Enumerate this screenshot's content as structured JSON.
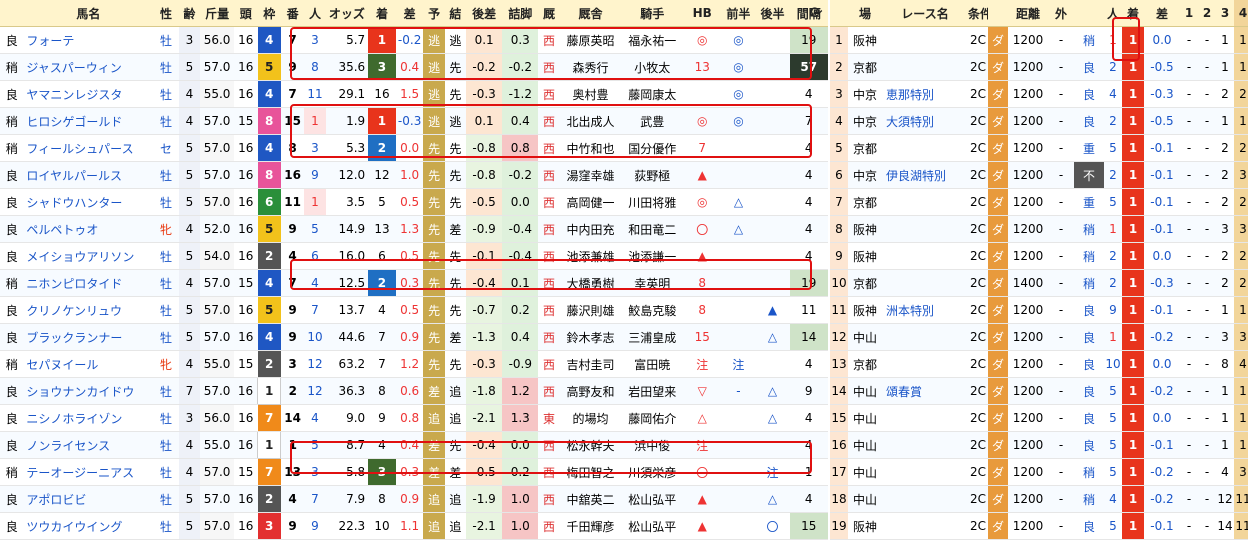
{
  "headers_left": [
    "",
    "馬名",
    "性",
    "齢",
    "斤量",
    "頭",
    "枠",
    "番",
    "人",
    "オッズ",
    "着",
    "差",
    "予",
    "結",
    "後差",
    "詰脚",
    "厩",
    "厩舎",
    "騎手",
    "HB",
    "前半",
    "後半",
    "間隔"
  ],
  "refresh_icon": "refresh-icon",
  "headers_right": [
    "",
    "場",
    "レース名",
    "条件",
    "",
    "距離",
    "外",
    "",
    "人",
    "着",
    "差",
    "1",
    "2",
    "3",
    "4"
  ],
  "rows": [
    {
      "cond": "良",
      "name": "フォーテ",
      "sex": "牡",
      "age": "3",
      "weight": "56.0",
      "heads": "16",
      "waku": "4",
      "uma": "7",
      "ninki": "3",
      "odds": "5.7",
      "finish": "1",
      "diff": "-0.2",
      "pred": "逃",
      "res": "逃",
      "go": "0.1",
      "tsume": "0.3",
      "zai": "西",
      "stable": "藤原英昭",
      "jockey": "福永祐一",
      "hb": "◎",
      "first": "◎",
      "second": "",
      "gap": "19",
      "rnk": "1",
      "place": "阪神",
      "race": "",
      "kind": "2C",
      "track": "ダ",
      "dist": "1200",
      "soto": "-",
      "field": "稍",
      "pop": "1",
      "fin2": "1",
      "d2": "0.0",
      "p1": "-",
      "p2": "-",
      "p3": "1",
      "p4": "1"
    },
    {
      "cond": "稍",
      "name": "ジャスパーウィン",
      "sex": "牡",
      "age": "5",
      "weight": "57.0",
      "heads": "16",
      "waku": "5",
      "uma": "9",
      "ninki": "8",
      "odds": "35.6",
      "finish": "3",
      "diff": "0.4",
      "pred": "逃",
      "res": "先",
      "go": "-0.2",
      "tsume": "-0.2",
      "zai": "西",
      "stable": "森秀行",
      "jockey": "小牧太",
      "hb": "13",
      "first": "◎",
      "second": "",
      "gap": "57",
      "rnk": "2",
      "place": "京都",
      "race": "",
      "kind": "2C",
      "track": "ダ",
      "dist": "1200",
      "soto": "-",
      "field": "良",
      "pop": "2",
      "fin2": "1",
      "d2": "-0.5",
      "p1": "-",
      "p2": "-",
      "p3": "1",
      "p4": "1"
    },
    {
      "cond": "良",
      "name": "ヤマニンレジスタ",
      "sex": "牡",
      "age": "4",
      "weight": "55.0",
      "heads": "16",
      "waku": "4",
      "uma": "7",
      "ninki": "11",
      "odds": "29.1",
      "finish": "16",
      "diff": "1.5",
      "pred": "逃",
      "res": "先",
      "go": "-0.3",
      "tsume": "-1.2",
      "zai": "西",
      "stable": "奥村豊",
      "jockey": "藤岡康太",
      "hb": "",
      "first": "◎",
      "second": "",
      "gap": "4",
      "rnk": "3",
      "place": "中京",
      "race": "恵那特別",
      "kind": "2C",
      "track": "ダ",
      "dist": "1200",
      "soto": "-",
      "field": "良",
      "pop": "4",
      "fin2": "1",
      "d2": "-0.3",
      "p1": "-",
      "p2": "-",
      "p3": "2",
      "p4": "2"
    },
    {
      "cond": "稍",
      "name": "ヒロシゲゴールド",
      "sex": "牡",
      "age": "4",
      "weight": "57.0",
      "heads": "15",
      "waku": "8",
      "uma": "15",
      "ninki": "1",
      "odds": "1.9",
      "finish": "1",
      "diff": "-0.3",
      "pred": "逃",
      "res": "逃",
      "go": "0.1",
      "tsume": "0.4",
      "zai": "西",
      "stable": "北出成人",
      "jockey": "武豊",
      "hb": "◎",
      "first": "◎",
      "second": "",
      "gap": "7",
      "rnk": "4",
      "place": "中京",
      "race": "大須特別",
      "kind": "2C",
      "track": "ダ",
      "dist": "1200",
      "soto": "-",
      "field": "良",
      "pop": "2",
      "fin2": "1",
      "d2": "-0.5",
      "p1": "-",
      "p2": "-",
      "p3": "1",
      "p4": "1"
    },
    {
      "cond": "稍",
      "name": "フィールシュパース",
      "sex": "セ",
      "age": "5",
      "weight": "57.0",
      "heads": "16",
      "waku": "4",
      "uma": "8",
      "ninki": "3",
      "odds": "5.3",
      "finish": "2",
      "diff": "0.0",
      "pred": "先",
      "res": "先",
      "go": "-0.8",
      "tsume": "0.8",
      "zai": "西",
      "stable": "中竹和也",
      "jockey": "国分優作",
      "hb": "7",
      "first": "",
      "second": "",
      "gap": "4",
      "rnk": "5",
      "place": "京都",
      "race": "",
      "kind": "2C",
      "track": "ダ",
      "dist": "1200",
      "soto": "-",
      "field": "重",
      "pop": "5",
      "fin2": "1",
      "d2": "-0.1",
      "p1": "-",
      "p2": "-",
      "p3": "2",
      "p4": "2"
    },
    {
      "cond": "良",
      "name": "ロイヤルパールス",
      "sex": "牡",
      "age": "5",
      "weight": "57.0",
      "heads": "16",
      "waku": "8",
      "uma": "16",
      "ninki": "9",
      "odds": "12.0",
      "finish": "12",
      "diff": "1.0",
      "pred": "先",
      "res": "先",
      "go": "-0.8",
      "tsume": "-0.2",
      "zai": "西",
      "stable": "湯窪幸雄",
      "jockey": "荻野極",
      "hb": "▲",
      "first": "",
      "second": "",
      "gap": "4",
      "rnk": "6",
      "place": "中京",
      "race": "伊良湖特別",
      "kind": "2C",
      "track": "ダ",
      "dist": "1200",
      "soto": "-",
      "field": "不",
      "pop": "2",
      "fin2": "1",
      "d2": "-0.1",
      "p1": "-",
      "p2": "-",
      "p3": "2",
      "p4": "3"
    },
    {
      "cond": "良",
      "name": "シャドウハンター",
      "sex": "牡",
      "age": "5",
      "weight": "57.0",
      "heads": "16",
      "waku": "6",
      "uma": "11",
      "ninki": "1",
      "odds": "3.5",
      "finish": "5",
      "diff": "0.5",
      "pred": "先",
      "res": "先",
      "go": "-0.5",
      "tsume": "0.0",
      "zai": "西",
      "stable": "高岡健一",
      "jockey": "川田将雅",
      "hb": "◎",
      "first": "△",
      "second": "",
      "gap": "4",
      "rnk": "7",
      "place": "京都",
      "race": "",
      "kind": "2C",
      "track": "ダ",
      "dist": "1200",
      "soto": "-",
      "field": "重",
      "pop": "5",
      "fin2": "1",
      "d2": "-0.1",
      "p1": "-",
      "p2": "-",
      "p3": "2",
      "p4": "2"
    },
    {
      "cond": "良",
      "name": "ペルペトゥオ",
      "sex": "牝",
      "age": "4",
      "weight": "52.0",
      "heads": "16",
      "waku": "5",
      "uma": "9",
      "ninki": "5",
      "odds": "14.9",
      "finish": "13",
      "diff": "1.3",
      "pred": "先",
      "res": "差",
      "go": "-0.9",
      "tsume": "-0.4",
      "zai": "西",
      "stable": "中内田充",
      "jockey": "和田竜二",
      "hb": "〇",
      "first": "△",
      "second": "",
      "gap": "4",
      "rnk": "8",
      "place": "阪神",
      "race": "",
      "kind": "2C",
      "track": "ダ",
      "dist": "1200",
      "soto": "-",
      "field": "稍",
      "pop": "1",
      "fin2": "1",
      "d2": "-0.1",
      "p1": "-",
      "p2": "-",
      "p3": "3",
      "p4": "3"
    },
    {
      "cond": "良",
      "name": "メイショウアリソン",
      "sex": "牡",
      "age": "5",
      "weight": "54.0",
      "heads": "16",
      "waku": "2",
      "uma": "4",
      "ninki": "6",
      "odds": "16.0",
      "finish": "6",
      "diff": "0.5",
      "pred": "先",
      "res": "先",
      "go": "-0.1",
      "tsume": "-0.4",
      "zai": "西",
      "stable": "池添兼雄",
      "jockey": "池添謙一",
      "hb": "▲",
      "first": "",
      "second": "",
      "gap": "4",
      "rnk": "9",
      "place": "阪神",
      "race": "",
      "kind": "2C",
      "track": "ダ",
      "dist": "1200",
      "soto": "-",
      "field": "稍",
      "pop": "2",
      "fin2": "1",
      "d2": "0.0",
      "p1": "-",
      "p2": "-",
      "p3": "2",
      "p4": "2"
    },
    {
      "cond": "稍",
      "name": "ニホンピロタイド",
      "sex": "牡",
      "age": "4",
      "weight": "57.0",
      "heads": "15",
      "waku": "4",
      "uma": "7",
      "ninki": "4",
      "odds": "12.5",
      "finish": "2",
      "diff": "0.3",
      "pred": "先",
      "res": "先",
      "go": "-0.4",
      "tsume": "0.1",
      "zai": "西",
      "stable": "大橋勇樹",
      "jockey": "幸英明",
      "hb": "8",
      "first": "",
      "second": "",
      "gap": "19",
      "rnk": "10",
      "place": "京都",
      "race": "",
      "kind": "2C",
      "track": "ダ",
      "dist": "1400",
      "soto": "-",
      "field": "稍",
      "pop": "2",
      "fin2": "1",
      "d2": "-0.3",
      "p1": "-",
      "p2": "-",
      "p3": "2",
      "p4": "2"
    },
    {
      "cond": "良",
      "name": "クリノケンリュウ",
      "sex": "牡",
      "age": "5",
      "weight": "57.0",
      "heads": "16",
      "waku": "5",
      "uma": "9",
      "ninki": "7",
      "odds": "13.7",
      "finish": "4",
      "diff": "0.5",
      "pred": "先",
      "res": "先",
      "go": "-0.7",
      "tsume": "0.2",
      "zai": "西",
      "stable": "藤沢則雄",
      "jockey": "鮫島克駿",
      "hb": "8",
      "first": "",
      "second": "▲",
      "gap": "11",
      "rnk": "11",
      "place": "阪神",
      "race": "洲本特別",
      "kind": "2C",
      "track": "ダ",
      "dist": "1200",
      "soto": "-",
      "field": "良",
      "pop": "9",
      "fin2": "1",
      "d2": "-0.1",
      "p1": "-",
      "p2": "-",
      "p3": "1",
      "p4": "1"
    },
    {
      "cond": "良",
      "name": "ブラックランナー",
      "sex": "牡",
      "age": "5",
      "weight": "57.0",
      "heads": "16",
      "waku": "4",
      "uma": "9",
      "ninki": "10",
      "odds": "44.6",
      "finish": "7",
      "diff": "0.9",
      "pred": "先",
      "res": "差",
      "go": "-1.3",
      "tsume": "0.4",
      "zai": "西",
      "stable": "鈴木孝志",
      "jockey": "三浦皇成",
      "hb": "15",
      "first": "",
      "second": "△",
      "gap": "14",
      "rnk": "12",
      "place": "中山",
      "race": "",
      "kind": "2C",
      "track": "ダ",
      "dist": "1200",
      "soto": "-",
      "field": "良",
      "pop": "1",
      "fin2": "1",
      "d2": "-0.2",
      "p1": "-",
      "p2": "-",
      "p3": "3",
      "p4": "3"
    },
    {
      "cond": "稍",
      "name": "セパヌイール",
      "sex": "牝",
      "age": "4",
      "weight": "55.0",
      "heads": "15",
      "waku": "2",
      "uma": "3",
      "ninki": "12",
      "odds": "63.2",
      "finish": "7",
      "diff": "1.2",
      "pred": "先",
      "res": "先",
      "go": "-0.3",
      "tsume": "-0.9",
      "zai": "西",
      "stable": "吉村圭司",
      "jockey": "富田暁",
      "hb": "注",
      "first": "注",
      "second": "",
      "gap": "4",
      "rnk": "13",
      "place": "京都",
      "race": "",
      "kind": "2C",
      "track": "ダ",
      "dist": "1200",
      "soto": "-",
      "field": "良",
      "pop": "10",
      "fin2": "1",
      "d2": "0.0",
      "p1": "-",
      "p2": "-",
      "p3": "8",
      "p4": "4"
    },
    {
      "cond": "良",
      "name": "ショウナンカイドウ",
      "sex": "牡",
      "age": "7",
      "weight": "57.0",
      "heads": "16",
      "waku": "1",
      "uma": "2",
      "ninki": "12",
      "odds": "36.3",
      "finish": "8",
      "diff": "0.6",
      "pred": "差",
      "res": "追",
      "go": "-1.8",
      "tsume": "1.2",
      "zai": "西",
      "stable": "高野友和",
      "jockey": "岩田望来",
      "hb": "▽",
      "first": "-",
      "second": "△",
      "gap": "9",
      "rnk": "14",
      "place": "中山",
      "race": "頌春賞",
      "kind": "2C",
      "track": "ダ",
      "dist": "1200",
      "soto": "-",
      "field": "良",
      "pop": "5",
      "fin2": "1",
      "d2": "-0.2",
      "p1": "-",
      "p2": "-",
      "p3": "1",
      "p4": "1"
    },
    {
      "cond": "良",
      "name": "ニシノホライゾン",
      "sex": "牡",
      "age": "3",
      "weight": "56.0",
      "heads": "16",
      "waku": "7",
      "uma": "14",
      "ninki": "4",
      "odds": "9.0",
      "finish": "9",
      "diff": "0.8",
      "pred": "追",
      "res": "追",
      "go": "-2.1",
      "tsume": "1.3",
      "zai": "東",
      "stable": "的場均",
      "jockey": "藤岡佑介",
      "hb": "△",
      "first": "",
      "second": "△",
      "gap": "4",
      "rnk": "15",
      "place": "中山",
      "race": "",
      "kind": "2C",
      "track": "ダ",
      "dist": "1200",
      "soto": "-",
      "field": "良",
      "pop": "5",
      "fin2": "1",
      "d2": "0.0",
      "p1": "-",
      "p2": "-",
      "p3": "1",
      "p4": "1"
    },
    {
      "cond": "良",
      "name": "ノンライセンス",
      "sex": "牡",
      "age": "4",
      "weight": "55.0",
      "heads": "16",
      "waku": "1",
      "uma": "1",
      "ninki": "5",
      "odds": "8.7",
      "finish": "4",
      "diff": "0.4",
      "pred": "差",
      "res": "先",
      "go": "-0.4",
      "tsume": "0.0",
      "zai": "西",
      "stable": "松永幹夫",
      "jockey": "浜中俊",
      "hb": "注",
      "first": "",
      "second": "",
      "gap": "4",
      "rnk": "16",
      "place": "中山",
      "race": "",
      "kind": "2C",
      "track": "ダ",
      "dist": "1200",
      "soto": "-",
      "field": "良",
      "pop": "5",
      "fin2": "1",
      "d2": "-0.1",
      "p1": "-",
      "p2": "-",
      "p3": "1",
      "p4": "1"
    },
    {
      "cond": "稍",
      "name": "テーオージーニアス",
      "sex": "牡",
      "age": "4",
      "weight": "57.0",
      "heads": "15",
      "waku": "7",
      "uma": "13",
      "ninki": "3",
      "odds": "5.8",
      "finish": "3",
      "diff": "0.3",
      "pred": "差",
      "res": "差",
      "go": "-0.5",
      "tsume": "0.2",
      "zai": "西",
      "stable": "梅田智之",
      "jockey": "川須栄彦",
      "hb": "〇",
      "first": "-",
      "second": "注",
      "gap": "1",
      "rnk": "17",
      "place": "中山",
      "race": "",
      "kind": "2C",
      "track": "ダ",
      "dist": "1200",
      "soto": "-",
      "field": "稍",
      "pop": "5",
      "fin2": "1",
      "d2": "-0.2",
      "p1": "-",
      "p2": "-",
      "p3": "4",
      "p4": "3"
    },
    {
      "cond": "良",
      "name": "アポロビビ",
      "sex": "牡",
      "age": "5",
      "weight": "57.0",
      "heads": "16",
      "waku": "2",
      "uma": "4",
      "ninki": "7",
      "odds": "7.9",
      "finish": "8",
      "diff": "0.9",
      "pred": "追",
      "res": "追",
      "go": "-1.9",
      "tsume": "1.0",
      "zai": "西",
      "stable": "中舘英二",
      "jockey": "松山弘平",
      "hb": "▲",
      "first": "",
      "second": "△",
      "gap": "4",
      "rnk": "18",
      "place": "中山",
      "race": "",
      "kind": "2C",
      "track": "ダ",
      "dist": "1200",
      "soto": "-",
      "field": "稍",
      "pop": "4",
      "fin2": "1",
      "d2": "-0.2",
      "p1": "-",
      "p2": "-",
      "p3": "12",
      "p4": "11"
    },
    {
      "cond": "良",
      "name": "ツウカイウイング",
      "sex": "牡",
      "age": "5",
      "weight": "57.0",
      "heads": "16",
      "waku": "3",
      "uma": "9",
      "ninki": "9",
      "odds": "22.3",
      "finish": "10",
      "diff": "1.1",
      "pred": "追",
      "res": "追",
      "go": "-2.1",
      "tsume": "1.0",
      "zai": "西",
      "stable": "千田輝彦",
      "jockey": "松山弘平",
      "hb": "▲",
      "first": "",
      "second": "〇",
      "gap": "15",
      "rnk": "19",
      "place": "阪神",
      "race": "",
      "kind": "2C",
      "track": "ダ",
      "dist": "1200",
      "soto": "-",
      "field": "良",
      "pop": "5",
      "fin2": "1",
      "d2": "-0.1",
      "p1": "-",
      "p2": "-",
      "p3": "14",
      "p4": "11"
    }
  ],
  "colors": {
    "waku1": "#ffffff",
    "waku2": "#555555",
    "waku3": "#e33030",
    "waku4": "#1f57c3",
    "waku5": "#f2c21b",
    "waku6": "#2a8f3a",
    "waku7": "#f08a1a",
    "waku8": "#e8549a",
    "highlight": "#e01010"
  }
}
